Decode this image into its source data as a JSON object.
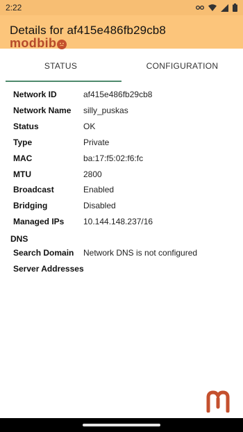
{
  "status_bar": {
    "time": "2:22",
    "icons": [
      "vpn-key-icon",
      "wifi-icon",
      "signal-icon",
      "battery-icon"
    ]
  },
  "app_bar": {
    "title": "Details for af415e486fb29cb8",
    "logo_text": "modbib",
    "background": "#fcc57b",
    "logo_color": "#b5492a"
  },
  "tabs": [
    {
      "label": "STATUS",
      "active": true
    },
    {
      "label": "CONFIGURATION",
      "active": false
    }
  ],
  "details": [
    {
      "label": "Network ID",
      "value": "af415e486fb29cb8"
    },
    {
      "label": "Network Name",
      "value": "silly_puskas"
    },
    {
      "label": "Status",
      "value": "OK"
    },
    {
      "label": "Type",
      "value": "Private"
    },
    {
      "label": "MAC",
      "value": "ba:17:f5:02:f6:fc"
    },
    {
      "label": "MTU",
      "value": "2800"
    },
    {
      "label": "Broadcast",
      "value": "Enabled"
    },
    {
      "label": "Bridging",
      "value": "Disabled"
    },
    {
      "label": "Managed IPs",
      "value": "10.144.148.237/16"
    }
  ],
  "dns": {
    "heading": "DNS",
    "rows": [
      {
        "label": "Search Domain",
        "value": "Network DNS is not configured"
      },
      {
        "label": "Server Addresses",
        "value": ""
      }
    ]
  },
  "accent_color": "#4e8a6c"
}
